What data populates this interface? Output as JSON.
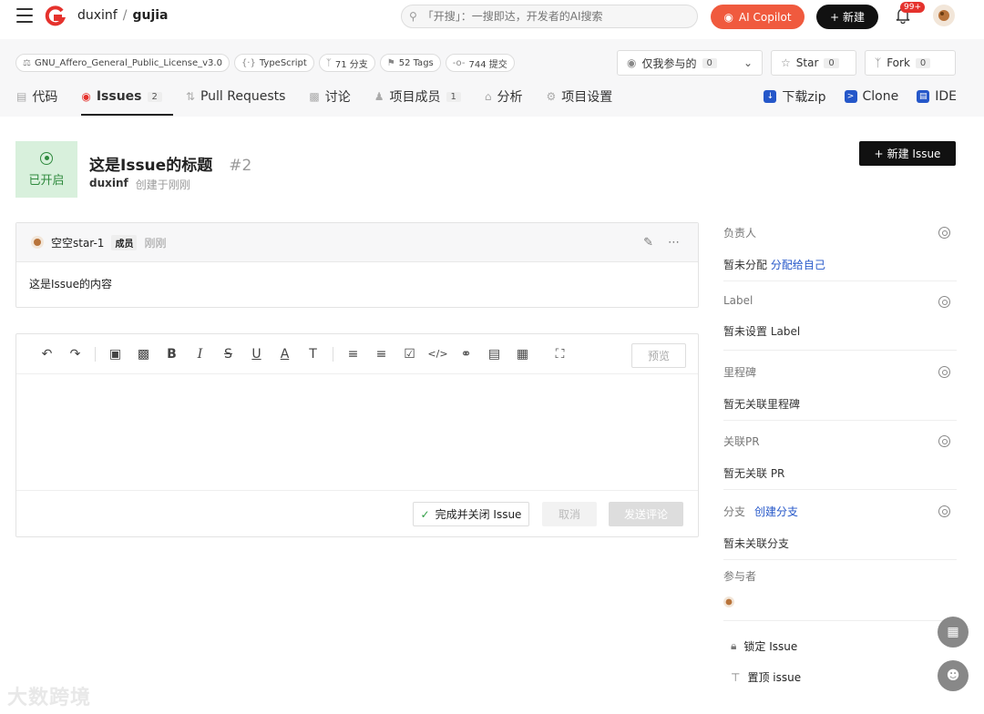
{
  "header": {
    "owner": "duxinf",
    "separator": "/",
    "repo": "gujia",
    "search_placeholder": "「开搜」：一搜即达，开发者的AI搜索",
    "ai_label": "AI Copilot",
    "new_label": "新建",
    "notif_count": "99+"
  },
  "repo_meta": {
    "license": "GNU_Affero_General_Public_License_v3.0",
    "language": "TypeScript",
    "branches": "71 分支",
    "tags": "52 Tags",
    "commits": "744 提交"
  },
  "controls": {
    "watch_label": "仅我参与的",
    "watch_count": "0",
    "star_label": "Star",
    "star_count": "0",
    "fork_label": "Fork",
    "fork_count": "0"
  },
  "tabs": [
    {
      "label": "代码"
    },
    {
      "label": "Issues",
      "count": "2"
    },
    {
      "label": "Pull Requests"
    },
    {
      "label": "讨论"
    },
    {
      "label": "项目成员",
      "count": "1"
    },
    {
      "label": "分析"
    },
    {
      "label": "项目设置"
    }
  ],
  "right_links": {
    "download": "下载zip",
    "clone": "Clone",
    "ide": "IDE"
  },
  "issue": {
    "status": "已开启",
    "title": "这是Issue的标题",
    "number": "#2",
    "author": "duxinf",
    "created": "创建于刚刚",
    "new_issue": "新建 Issue"
  },
  "comment": {
    "user": "空空star-1",
    "role": "成员",
    "time": "刚刚",
    "body": "这是Issue的内容"
  },
  "editor": {
    "preview": "预览",
    "close_issue": "完成并关闭 Issue",
    "cancel": "取消",
    "send": "发送评论"
  },
  "sidebar": {
    "assignee_label": "负责人",
    "assignee_value": "暂未分配",
    "assign_self": "分配给自己",
    "label_label": "Label",
    "label_value": "暂未设置 Label",
    "milestone_label": "里程碑",
    "milestone_value": "暂无关联里程碑",
    "pr_label": "关联PR",
    "pr_value": "暂无关联 PR",
    "branch_label": "分支",
    "branch_create": "创建分支",
    "branch_value": "暂未关联分支",
    "participants_label": "参与者",
    "lock": "锁定 Issue",
    "pin": "置顶 issue"
  },
  "watermark": "大数跨境",
  "colors": {
    "accent_red": "#f05a3e",
    "status_green": "#2f8a3e",
    "link_blue": "#2557c9"
  }
}
